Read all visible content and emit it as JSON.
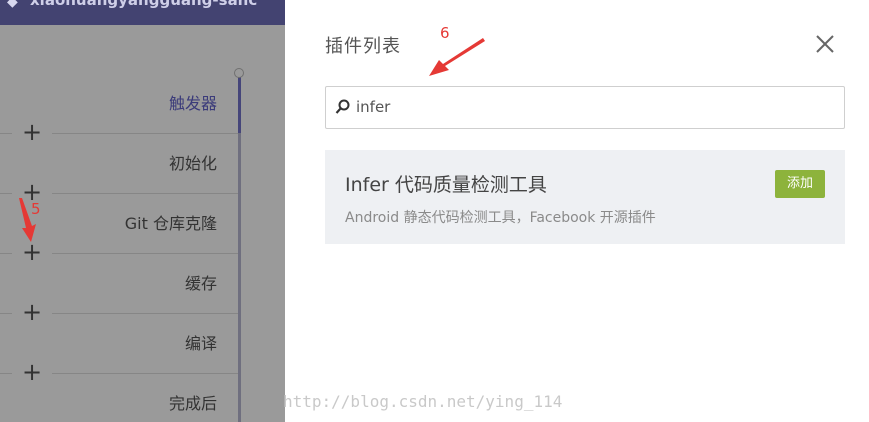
{
  "header": {
    "title": "xiaohuangyangguang-sanc",
    "icon": "diamond-icon"
  },
  "pipeline": {
    "stages": [
      {
        "label": "触发器",
        "active": true
      },
      {
        "label": "初始化",
        "active": false
      },
      {
        "label": "Git 仓库克隆",
        "active": false
      },
      {
        "label": "缓存",
        "active": false
      },
      {
        "label": "编译",
        "active": false
      },
      {
        "label": "完成后",
        "active": false
      }
    ],
    "add_symbol": "+"
  },
  "annotations": {
    "step5": "5",
    "step6": "6"
  },
  "drawer": {
    "title": "插件列表",
    "search": {
      "value": "infer",
      "icon": "search-icon"
    },
    "results": [
      {
        "title": "Infer 代码质量检测工具",
        "description": "Android 静态代码检测工具，Facebook 开源插件",
        "action_label": "添加"
      }
    ]
  },
  "watermark": "http://blog.csdn.net/ying_114",
  "colors": {
    "overlay": "#9a9a9a",
    "topbar": "#434371",
    "add_button": "#8db33c",
    "annotation": "#e53935",
    "card_bg": "#eef0f3"
  }
}
